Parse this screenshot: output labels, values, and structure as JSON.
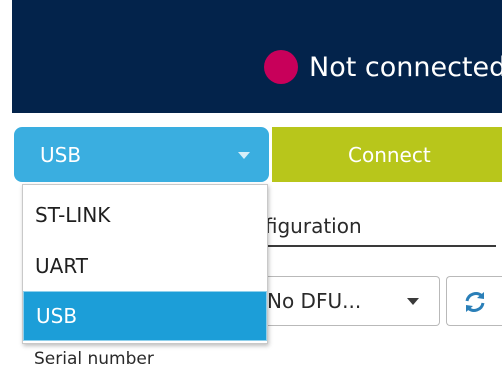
{
  "header": {
    "status_text": "Not connected",
    "status_color": "#c8005a"
  },
  "toolbar": {
    "interface_select": "USB",
    "connect_label": "Connect",
    "interface_color": "#3aaee0",
    "connect_color": "#b8c61b"
  },
  "dropdown": {
    "options": [
      "ST-LINK",
      "UART",
      "USB"
    ],
    "selected": "USB",
    "selected_color": "#1c9ed8"
  },
  "config": {
    "tab_label": "Configuration",
    "dfu_select": "No DFU...",
    "refresh_icon": "refresh-icon",
    "serial_label": "Serial number"
  }
}
